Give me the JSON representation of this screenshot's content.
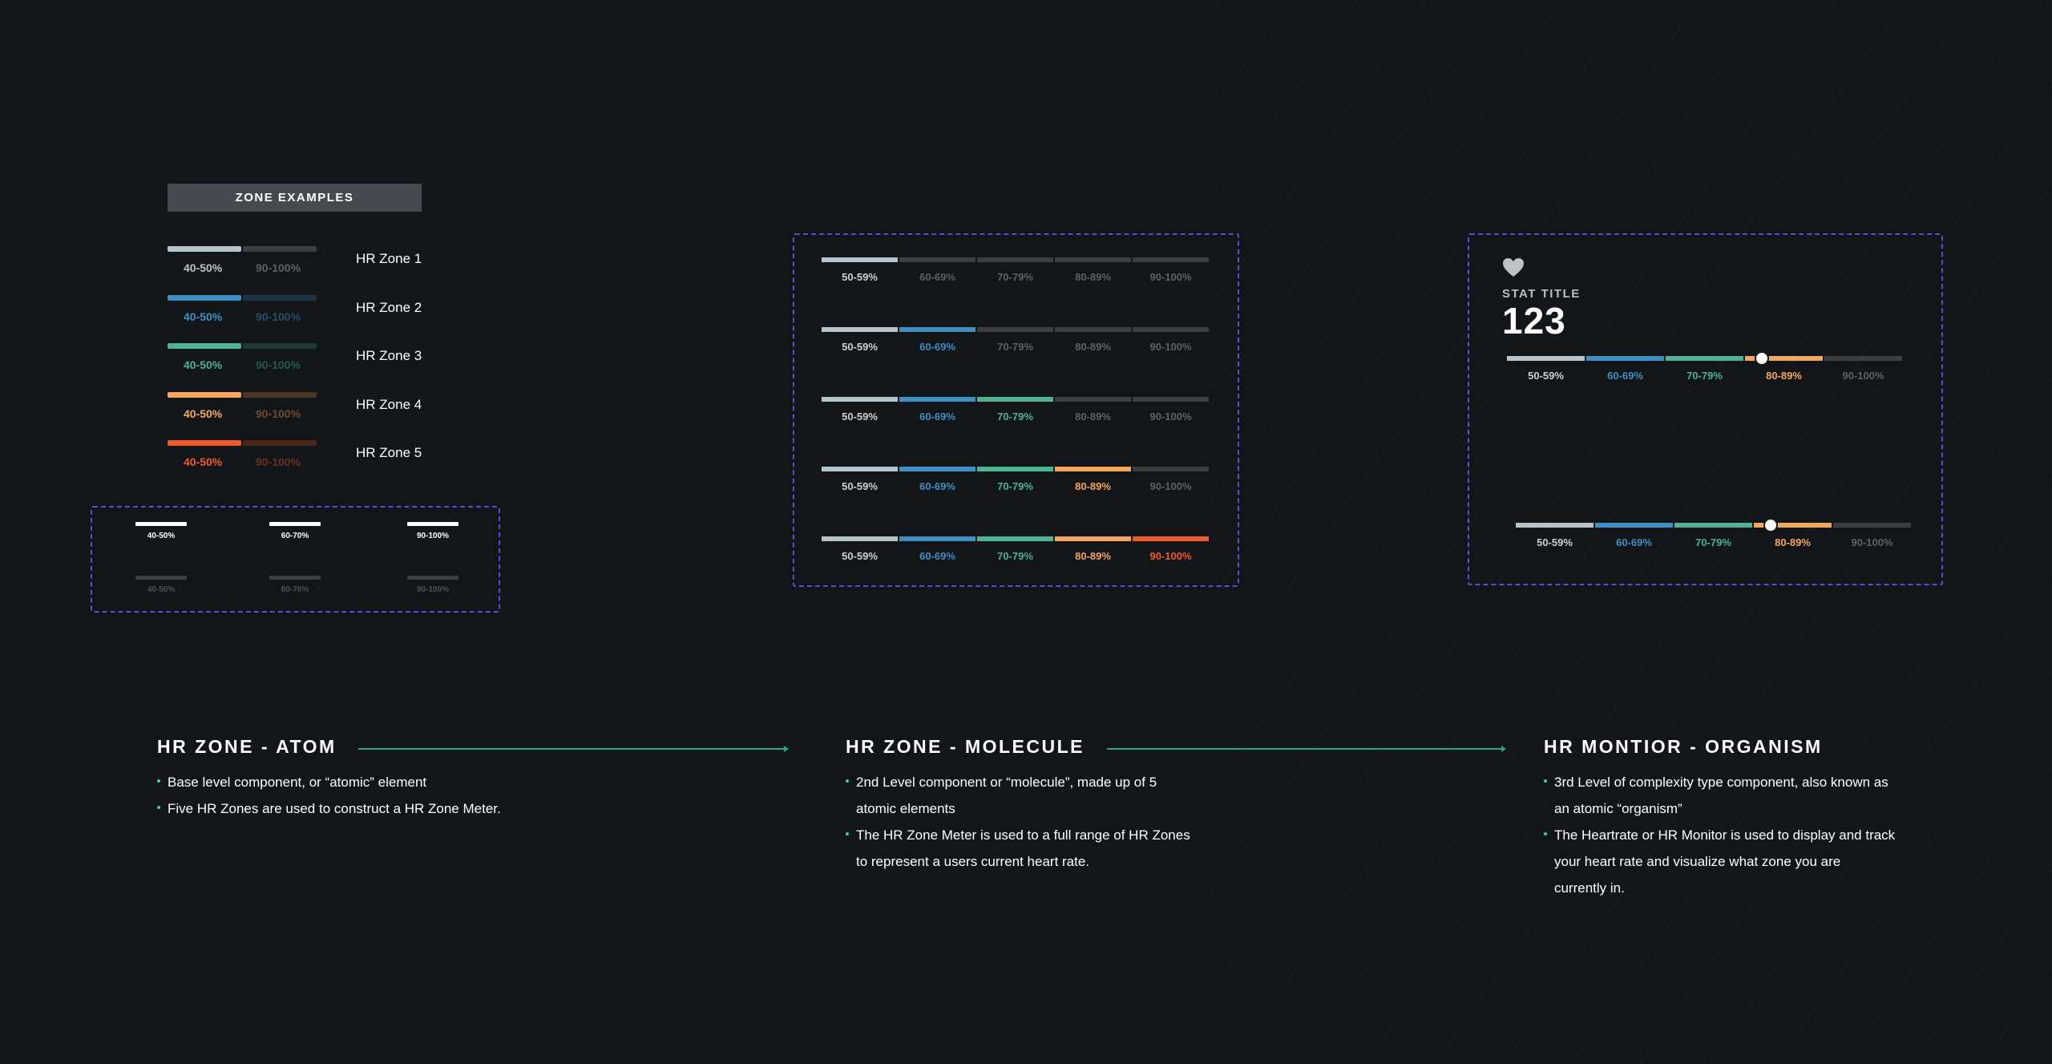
{
  "atom": {
    "header": "ZONE EXAMPLES",
    "zones": [
      {
        "name": "HR Zone 1",
        "on_label": "40-50%",
        "off_label": "90-100%",
        "color": "#b8c4cc",
        "off_color": "#3a3f44",
        "off_text": "#5b6166"
      },
      {
        "name": "HR Zone 2",
        "on_label": "40-50%",
        "off_label": "90-100%",
        "color": "#3f8fc4",
        "off_color": "#1f3442",
        "off_text": "#2a4e66"
      },
      {
        "name": "HR Zone 3",
        "on_label": "40-50%",
        "off_label": "90-100%",
        "color": "#4eb38f",
        "off_color": "#1f3a31",
        "off_text": "#2a5a48"
      },
      {
        "name": "HR Zone 4",
        "on_label": "40-50%",
        "off_label": "90-100%",
        "color": "#f4a65d",
        "off_color": "#4a3626",
        "off_text": "#6b4c31"
      },
      {
        "name": "HR Zone 5",
        "on_label": "40-50%",
        "off_label": "90-100%",
        "color": "#f05a28",
        "off_color": "#4a2519",
        "off_text": "#6b3020"
      }
    ],
    "states_active": [
      "40-50%",
      "60-70%",
      "90-100%"
    ],
    "states_inactive": [
      "40-50%",
      "60-70%",
      "90-100%"
    ]
  },
  "molecule": {
    "segments": [
      "50-59%",
      "60-69%",
      "70-79%",
      "80-89%",
      "90-100%"
    ],
    "colors": [
      "#b8c4cc",
      "#3f8fc4",
      "#4eb38f",
      "#f4a65d",
      "#f05a28"
    ],
    "inactive_bar": "#3a3f44",
    "inactive_text": "#5b6166",
    "first_label_color": "#c9d1d6",
    "active_counts": [
      1,
      2,
      3,
      4,
      5
    ]
  },
  "organism": {
    "stat_title": "STAT TITLE",
    "stat_value": "123",
    "segments": [
      "50-59%",
      "60-69%",
      "70-79%",
      "80-89%",
      "90-100%"
    ],
    "active_zone_index": 3,
    "knob_position_in_zone": 0.2
  },
  "sections": [
    {
      "title": "HR ZONE - ATOM",
      "bullets": [
        "Base level component, or “atomic” element",
        "Five HR Zones are used to construct a HR Zone Meter."
      ]
    },
    {
      "title": "HR ZONE - MOLECULE",
      "bullets": [
        "2nd Level component or “molecule”, made up of 5 atomic elements",
        "The HR Zone Meter is used to a full range of HR Zones to represent a users current heart rate."
      ]
    },
    {
      "title": "HR MONTIOR - ORGANISM",
      "bullets": [
        "3rd Level of complexity type component, also known as an atomic  “organism”",
        "The Heartrate or HR Monitor is used to display and track your heart rate and visualize what zone you are currently in."
      ]
    }
  ],
  "accent_color": "#2ba57c",
  "dash_color": "#5a4fd0"
}
